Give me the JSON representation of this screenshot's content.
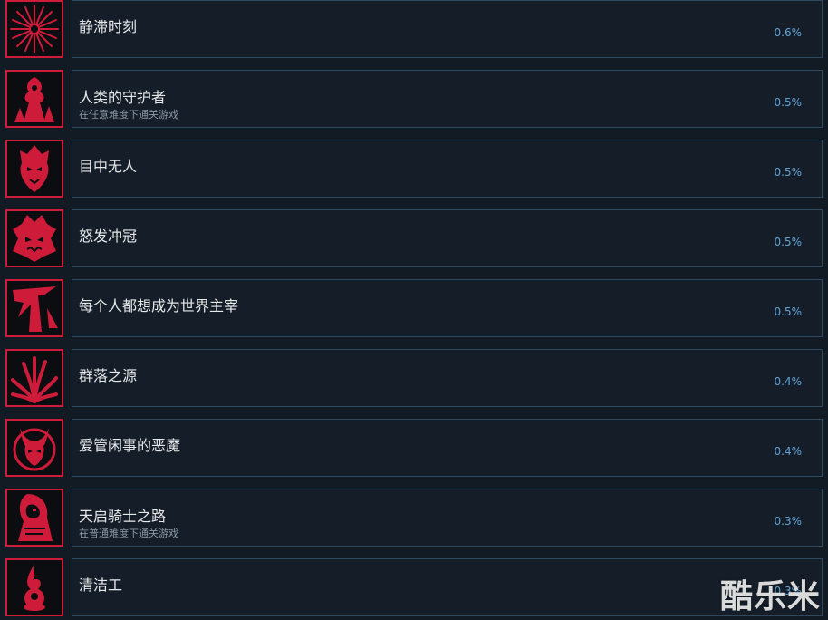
{
  "achievements": [
    {
      "title": "静滞时刻",
      "description": "",
      "percent": "0.6%",
      "icon": "starburst-icon",
      "accent": "#cf1b3a"
    },
    {
      "title": "人类的守护者",
      "description": "在任意难度下通关游戏",
      "percent": "0.5%",
      "icon": "guardian-icon",
      "accent": "#cf1b3a"
    },
    {
      "title": "目中无人",
      "description": "",
      "percent": "0.5%",
      "icon": "mask-face-icon",
      "accent": "#cf1b3a"
    },
    {
      "title": "怒发冲冠",
      "description": "",
      "percent": "0.5%",
      "icon": "rage-head-icon",
      "accent": "#cf1b3a"
    },
    {
      "title": "每个人都想成为世界主宰",
      "description": "",
      "percent": "0.5%",
      "icon": "blade-figure-icon",
      "accent": "#cf1b3a"
    },
    {
      "title": "群落之源",
      "description": "",
      "percent": "0.4%",
      "icon": "tendrils-icon",
      "accent": "#cf1b3a"
    },
    {
      "title": "爱管闲事的恶魔",
      "description": "",
      "percent": "0.4%",
      "icon": "horned-demon-icon",
      "accent": "#cf1b3a"
    },
    {
      "title": "天启骑士之路",
      "description": "在普通难度下通关游戏",
      "percent": "0.3%",
      "icon": "hooded-rider-icon",
      "accent": "#cf1b3a"
    },
    {
      "title": "清洁工",
      "description": "",
      "percent": "0.3%",
      "icon": "flame-vase-icon",
      "accent": "#cf1b3a"
    }
  ],
  "watermark": "酷乐米"
}
